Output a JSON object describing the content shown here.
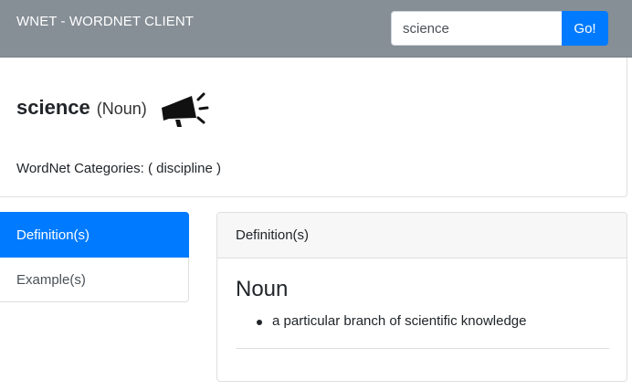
{
  "navbar": {
    "brand": "WNET - WORDNET CLIENT",
    "search_value": "science",
    "search_button": "Go!"
  },
  "entry": {
    "word": "science",
    "pos": "(Noun)",
    "speak_icon": "megaphone-icon",
    "categories": "WordNet Categories: ( discipline )"
  },
  "tabs": [
    {
      "label": "Definition(s)",
      "active": true
    },
    {
      "label": "Example(s)",
      "active": false
    }
  ],
  "definitions_panel": {
    "header": "Definition(s)",
    "pos_heading": "Noun",
    "items": [
      "a particular branch of scientific knowledge"
    ]
  },
  "colors": {
    "navbar": "#868e96",
    "accent": "#007bff"
  }
}
